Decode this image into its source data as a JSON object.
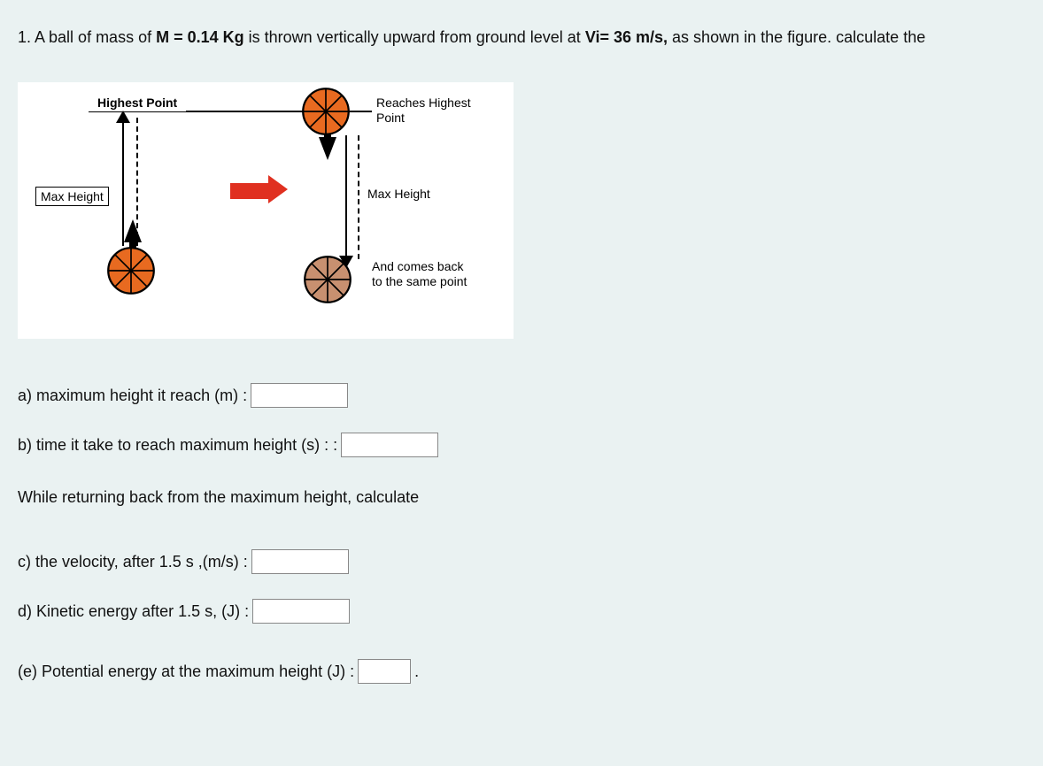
{
  "question": {
    "prefix": "1. A ball of mass of ",
    "mass": "M = 0.14 Kg",
    "mid": " is thrown vertically upward from ground level at ",
    "vi": "Vi= 36 m/s,",
    "suffix": " as shown in the figure. calculate the"
  },
  "diagram": {
    "highest_point": "Highest Point",
    "max_height_left": "Max Height",
    "reaches_line1": "Reaches Highest",
    "reaches_line2": "Point",
    "max_height_right": "Max Height",
    "comes_back_line1": "And comes back",
    "comes_back_line2": "to the same point"
  },
  "parts": {
    "a": "a) maximum height it reach (m)  :",
    "b": "b) time it take to reach maximum height (s) : :",
    "section": "While returning back from the maximum height, calculate",
    "c": "c) the velocity, after 1.5 s ,(m/s) :",
    "d": "d) Kinetic energy after 1.5 s, (J) :",
    "e": "(e) Potential energy at the maximum height  (J) :",
    "period": "."
  },
  "inputs": {
    "a": "",
    "b": "",
    "c": "",
    "d": "",
    "e": ""
  }
}
